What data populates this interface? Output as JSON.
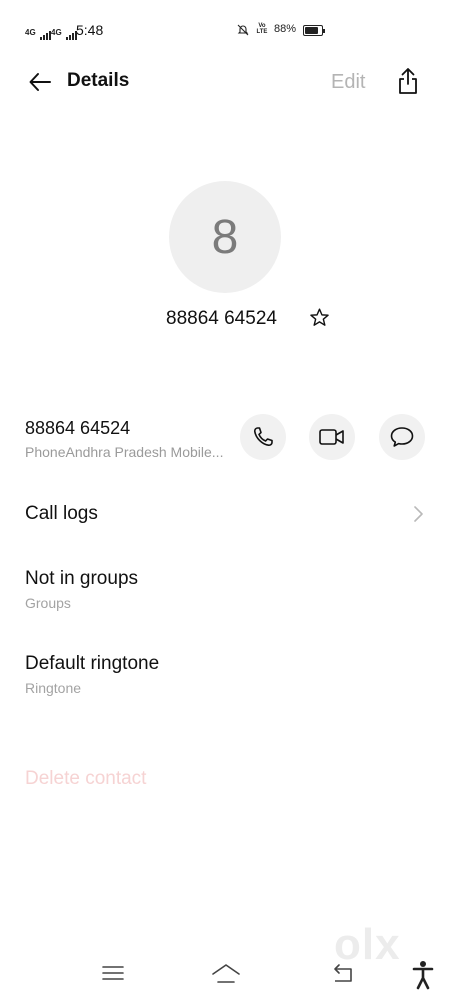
{
  "status_bar": {
    "sim1": "4G",
    "sim2": "4G",
    "time": "5:48",
    "volte_top": "Vo",
    "volte_bottom": "LTE",
    "battery": "88%",
    "battery_level": 0.88
  },
  "header": {
    "title": "Details",
    "edit_label": "Edit"
  },
  "contact": {
    "initial": "8",
    "name": "88864 64524"
  },
  "phone": {
    "number": "88864 64524",
    "label": "PhoneAndhra Pradesh Mobile..."
  },
  "items": [
    {
      "title": "Call logs"
    },
    {
      "title": "Not in groups",
      "subtitle": "Groups"
    },
    {
      "title": "Default ringtone",
      "subtitle": "Ringtone"
    }
  ],
  "delete_label": "Delete contact",
  "watermark": "olx",
  "icons": {
    "back": "arrow-left-icon",
    "share": "share-icon",
    "favorite": "star-outline-icon",
    "call": "phone-icon",
    "video": "video-icon",
    "message": "message-bubble-icon",
    "chevron": "chevron-right-icon",
    "nav_menu": "menu-icon",
    "nav_home": "home-icon",
    "nav_back": "back-icon",
    "accessibility": "accessibility-icon"
  },
  "colors": {
    "accent_edit": "#b4b4b4",
    "delete": "#f6d3d3",
    "avatar_bg": "#efefef"
  }
}
